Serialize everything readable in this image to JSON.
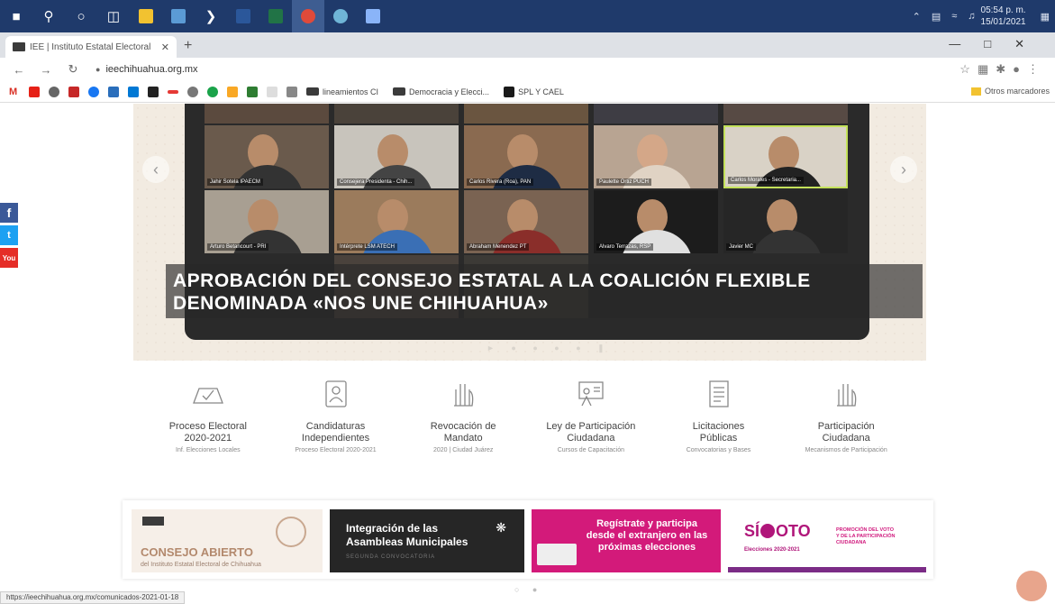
{
  "taskbar": {
    "apps": [
      "windows-start",
      "search",
      "cortana",
      "task-view",
      "file-explorer",
      "photos",
      "powershell",
      "word",
      "excel",
      "chrome",
      "webcam",
      "snip"
    ],
    "clock_time": "05:54 p. m.",
    "clock_date": "15/01/2021"
  },
  "browser": {
    "tab_title": "IEE | Instituto Estatal Electoral",
    "url": "ieechihuahua.org.mx",
    "bookmarks": [
      {
        "label": "lineamientos CI"
      },
      {
        "label": "Democracia y Elecci..."
      },
      {
        "label": "SPL Y CAEL"
      }
    ],
    "other_bookmarks": "Otros marcadores"
  },
  "hero": {
    "caption": "APROBACIÓN DEL CONSEJO ESTATAL A LA COALICIÓN FLEXIBLE DENOMINADA «NOS UNE CHIHUAHUA»",
    "tiles": [
      "Jahir Sotela IPAECM",
      "Consejera Presidenta - Chih...",
      "Carlos Rivera (Roa), PAN",
      "Paulette Ortiz PUCH",
      "Carlos Morales - Secretaria...",
      "Arturo Betancourt - PRI",
      "Intérprete LSM ATECH",
      "Abraham Menendez PT",
      "Alvaro Terrazas, RSP",
      "Javier MC"
    ]
  },
  "social": {
    "facebook": "f",
    "twitter": "t",
    "youtube": "You"
  },
  "services": [
    {
      "title1": "Proceso Electoral",
      "title2": "2020-2021",
      "sub": "Inf. Elecciones Locales"
    },
    {
      "title1": "Candidaturas",
      "title2": "Independientes",
      "sub": "Proceso Electoral 2020-2021"
    },
    {
      "title1": "Revocación de",
      "title2": "Mandato",
      "sub": "2020 | Ciudad Juárez"
    },
    {
      "title1": "Ley de Participación",
      "title2": "Ciudadana",
      "sub": "Cursos de Capacitación"
    },
    {
      "title1": "Licitaciones",
      "title2": "Públicas",
      "sub": "Convocatorias y Bases"
    },
    {
      "title1": "Participación",
      "title2": "Ciudadana",
      "sub": "Mecanismos de Participación"
    }
  ],
  "banners": {
    "b1_title": "CONSEJO ABIERTO",
    "b1_sub": "del Instituto Estatal Electoral de Chihuahua",
    "b2_title1": "Integración de las",
    "b2_title2": "Asambleas Municipales",
    "b2_sub": "SEGUNDA CONVOCATORIA",
    "b3_title1": "Regístrate y participa",
    "b3_title2": "desde el extranjero en las",
    "b3_title3": "próximas elecciones",
    "b4_logo_a": "SÍ",
    "b4_logo_b": "OTO",
    "b4_elecciones": "Elecciones 2020-2021",
    "b4_promo1": "PROMOCIÓN DEL VOTO",
    "b4_promo2": "Y DE LA PARTICIPACIÓN",
    "b4_promo3": "CIUDADANA"
  },
  "status_url": "https://ieechihuahua.org.mx/comunicados-2021-01-18"
}
